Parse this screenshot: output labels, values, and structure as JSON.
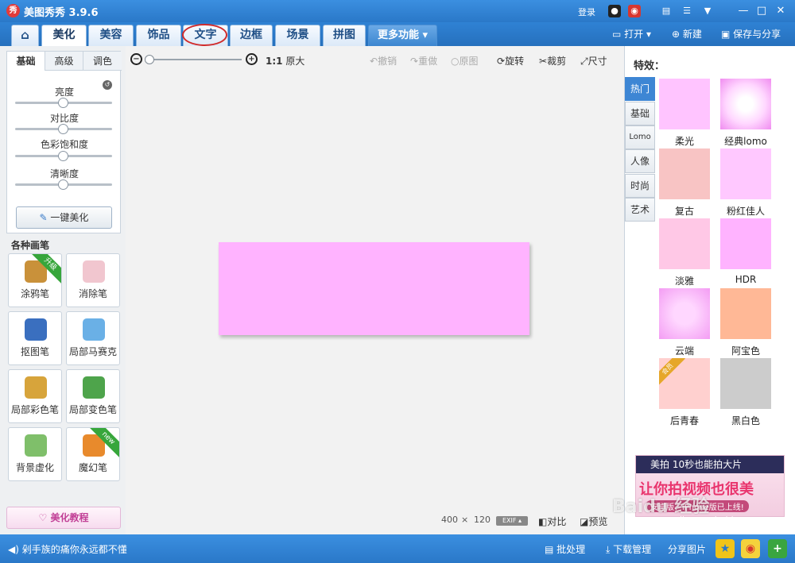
{
  "app": {
    "logo_text": "秀",
    "title": "美图秀秀 3.9.6",
    "login": "登录"
  },
  "window_controls": {
    "minimize": "—",
    "maximize": "□",
    "close": "✕"
  },
  "tabs": [
    {
      "label": ""
    },
    {
      "label": "美化"
    },
    {
      "label": "美容"
    },
    {
      "label": "饰品"
    },
    {
      "label": "文字"
    },
    {
      "label": "边框"
    },
    {
      "label": "场景"
    },
    {
      "label": "拼图"
    },
    {
      "label": "更多功能 ▾"
    }
  ],
  "file_actions": {
    "open": "打开 ▾",
    "new": "新建",
    "save": "保存与分享"
  },
  "adjust": {
    "tabs": [
      "基础",
      "高级",
      "调色"
    ],
    "sliders": [
      {
        "label": "亮度",
        "value": 0.5
      },
      {
        "label": "对比度",
        "value": 0.5
      },
      {
        "label": "色彩饱和度",
        "value": 0.5
      },
      {
        "label": "清晰度",
        "value": 0.5
      }
    ],
    "onekey": "一键美化"
  },
  "pens": {
    "title": "各种画笔",
    "items": [
      {
        "label": "涂鸦笔",
        "badge": "升级",
        "color": "#c9913a"
      },
      {
        "label": "消除笔",
        "badge": "",
        "color": "#f1c6cf"
      },
      {
        "label": "抠图笔",
        "badge": "",
        "color": "#3a6fbf"
      },
      {
        "label": "局部马赛克",
        "badge": "",
        "color": "#6ab0e6"
      },
      {
        "label": "局部彩色笔",
        "badge": "",
        "color": "#d7a43b"
      },
      {
        "label": "局部变色笔",
        "badge": "",
        "color": "#4ea44b"
      },
      {
        "label": "背景虚化",
        "badge": "",
        "color": "#7fbf6a"
      },
      {
        "label": "魔幻笔",
        "badge": "new",
        "color": "#e88a2c"
      }
    ]
  },
  "tutorial": "美化教程",
  "toolbar": {
    "ratio": "1:1",
    "original_size": "原大",
    "undo": "撤销",
    "redo": "重做",
    "original": "原图",
    "rotate": "旋转",
    "crop": "裁剪",
    "resize": "尺寸"
  },
  "canvas": {
    "image_color": "#ffb3ff",
    "width": "400",
    "x": "×",
    "height": "120"
  },
  "bottom_tools": {
    "exif": "EXIF ▴",
    "compare": "对比",
    "preview": "预览"
  },
  "effects": {
    "title": "特效：",
    "categories": [
      "热门",
      "基础",
      "Lomo",
      "人像",
      "时尚",
      "艺术"
    ],
    "items": [
      {
        "label": "柔光",
        "color": "#ffc4ff"
      },
      {
        "label": "经典lomo",
        "color": "#ffd7ff"
      },
      {
        "label": "复古",
        "color": "#f8c4c4"
      },
      {
        "label": "粉红佳人",
        "color": "#ffc8ff"
      },
      {
        "label": "淡雅",
        "color": "#ffc8e6"
      },
      {
        "label": "HDR",
        "color": "#ffb3ff"
      },
      {
        "label": "云端",
        "color": "#ffc0ff"
      },
      {
        "label": "阿宝色",
        "color": "#ffb896"
      },
      {
        "label": "后青春",
        "color": "#ffd0cf",
        "badge": "会员"
      },
      {
        "label": "黑白色",
        "color": "#cccccc"
      }
    ]
  },
  "promo": {
    "top": "美拍 10秒也能拍大片",
    "main": "让你拍视频也很美",
    "sub": "安卓版、iPhone版已上线!"
  },
  "status": {
    "message": "剁手族的痛你永远都不懂",
    "batch": "批处理",
    "download": "下载管理",
    "share": "分享图片"
  },
  "watermark": {
    "brand": "Baidu 经验",
    "url": "jingyan.baidu.com"
  }
}
